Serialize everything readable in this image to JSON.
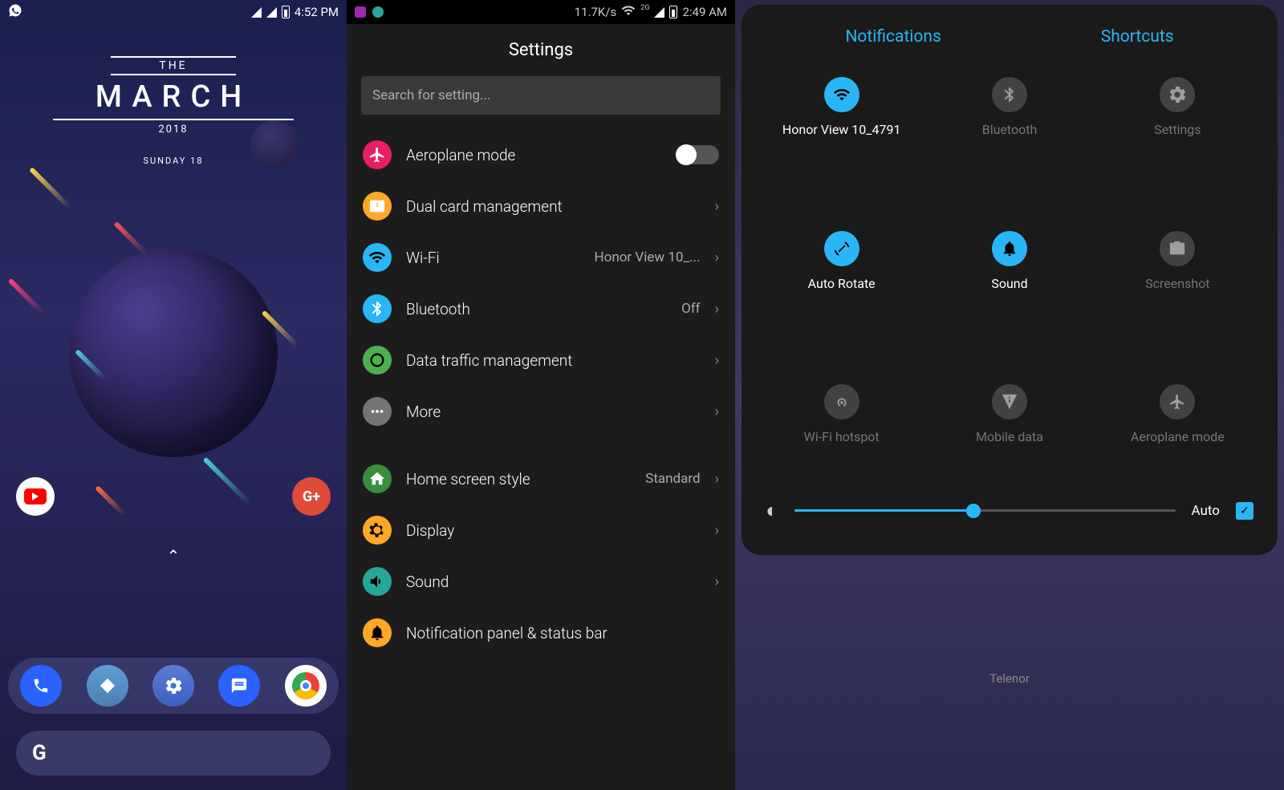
{
  "screen1": {
    "status": {
      "time": "4:52 PM"
    },
    "widget": {
      "the": "THE",
      "month": "MARCH",
      "year": "2018",
      "date": "SUNDAY 18"
    }
  },
  "screen2": {
    "status": {
      "speed": "11.7K/s",
      "net": "2G",
      "time": "2:49 AM"
    },
    "title": "Settings",
    "search_placeholder": "Search for setting...",
    "items": [
      {
        "label": "Aeroplane mode",
        "value": "",
        "toggle": true
      },
      {
        "label": "Dual card management",
        "value": ""
      },
      {
        "label": "Wi-Fi",
        "value": "Honor View 10_..."
      },
      {
        "label": "Bluetooth",
        "value": "Off"
      },
      {
        "label": "Data traffic management",
        "value": ""
      },
      {
        "label": "More",
        "value": ""
      },
      {
        "label": "Home screen style",
        "value": "Standard"
      },
      {
        "label": "Display",
        "value": ""
      },
      {
        "label": "Sound",
        "value": ""
      },
      {
        "label": "Notification panel & status bar",
        "value": ""
      }
    ]
  },
  "screen3": {
    "tabs": {
      "notifications": "Notifications",
      "shortcuts": "Shortcuts"
    },
    "tiles": [
      {
        "label": "Honor View 10_4791",
        "on": true
      },
      {
        "label": "Bluetooth",
        "on": false
      },
      {
        "label": "Settings",
        "on": false
      },
      {
        "label": "Auto Rotate",
        "on": true
      },
      {
        "label": "Sound",
        "on": true
      },
      {
        "label": "Screenshot",
        "on": false
      },
      {
        "label": "Wi-Fi hotspot",
        "on": false
      },
      {
        "label": "Mobile data",
        "on": false
      },
      {
        "label": "Aeroplane mode",
        "on": false
      }
    ],
    "auto_label": "Auto",
    "carrier": "Telenor"
  }
}
